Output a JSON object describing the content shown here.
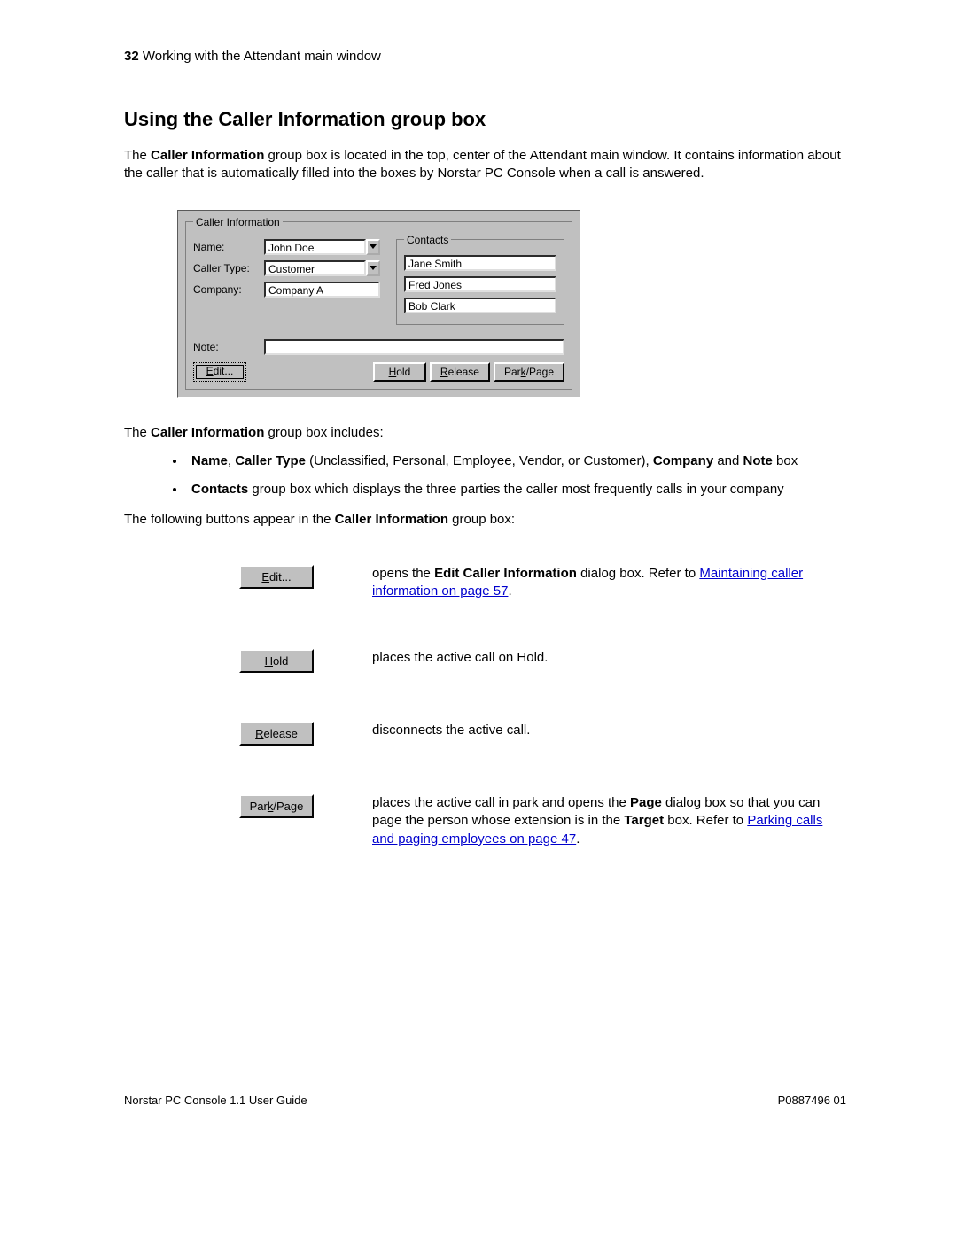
{
  "header": {
    "page_num": "32",
    "section": "Working with the Attendant main window"
  },
  "heading": "Using the Caller Information group box",
  "intro_parts": {
    "p1a": "The ",
    "p1b": "Caller Information",
    "p1c": " group box is located in the top, center of the Attendant main window. It contains information about the caller that is automatically filled into the boxes by Norstar PC Console when a call is answered."
  },
  "groupbox": {
    "title": "Caller Information",
    "contacts_title": "Contacts",
    "labels": {
      "name": "Name:",
      "caller_type": "Caller Type:",
      "company": "Company:",
      "note": "Note:"
    },
    "values": {
      "name": "John Doe",
      "caller_type": "Customer",
      "company": "Company A",
      "note": ""
    },
    "contacts": [
      "Jane Smith",
      "Fred Jones",
      "Bob Clark"
    ],
    "buttons": {
      "edit": "Edit...",
      "hold": "Hold",
      "release": "Release",
      "parkpage": "Park/Page"
    }
  },
  "after_fig_parts": {
    "a": "The ",
    "b": "Caller Information",
    "c": " group box includes:"
  },
  "bullets": {
    "b1": {
      "a": "Name",
      "b": ", ",
      "c": "Caller Type",
      "d": " (Unclassified, Personal, Employee, Vendor, or Customer), ",
      "e": "Company",
      "f": " and ",
      "g": "Note",
      "h": " box"
    },
    "b2": {
      "a": "Contacts",
      "b": " group box which displays the three parties the caller most frequently calls in your company"
    }
  },
  "before_table_parts": {
    "a": "The following buttons appear in the ",
    "b": "Caller Information",
    "c": " group box:"
  },
  "btable": {
    "edit": {
      "label": "Edit...",
      "d1": "opens the ",
      "d2": "Edit Caller Information",
      "d3": " dialog box. Refer to ",
      "link": "Maintaining caller information on page 57",
      "d4": "."
    },
    "hold": {
      "label": "Hold",
      "desc": "places the active call on Hold."
    },
    "release": {
      "label": "Release",
      "desc": "disconnects the active call."
    },
    "parkpage": {
      "label": "Park/Page",
      "d1": "places the active call in park and opens the ",
      "d2": "Page",
      "d3": " dialog box so that you can page the person whose extension is in the ",
      "d4": "Target",
      "d5": " box. Refer to ",
      "link": "Parking calls and paging employees on page 47",
      "d6": "."
    }
  },
  "footer": {
    "left": "Norstar PC Console 1.1 User Guide",
    "right": "P0887496 01"
  }
}
